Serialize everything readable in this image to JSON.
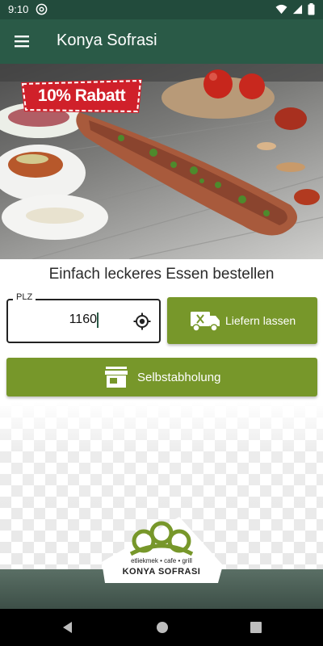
{
  "status_bar": {
    "time": "9:10",
    "icons": [
      "at-sign-icon",
      "wifi-icon",
      "signal-icon",
      "battery-icon"
    ]
  },
  "app_bar": {
    "title": "Konya Sofrasi",
    "menu_icon": "hamburger-menu-icon"
  },
  "hero": {
    "badge_text": "10% Rabatt",
    "image": "lahmacun-food-photo"
  },
  "order": {
    "tagline": "Einfach leckeres Essen bestellen",
    "plz_label": "PLZ",
    "plz_value": "1160",
    "deliver_label": "Liefern lassen",
    "pickup_label": "Selbstabholung"
  },
  "logo": {
    "subtitle": "etliekmek • cafe • grill",
    "name": "KONYA SOFRASI"
  },
  "colors": {
    "status_bar": "#224b3c",
    "app_bar": "#2a5a47",
    "button_green": "#77972a",
    "badge_red": "#d0202a"
  },
  "nav": {
    "icons": [
      "back-icon",
      "home-icon",
      "recents-icon"
    ]
  }
}
